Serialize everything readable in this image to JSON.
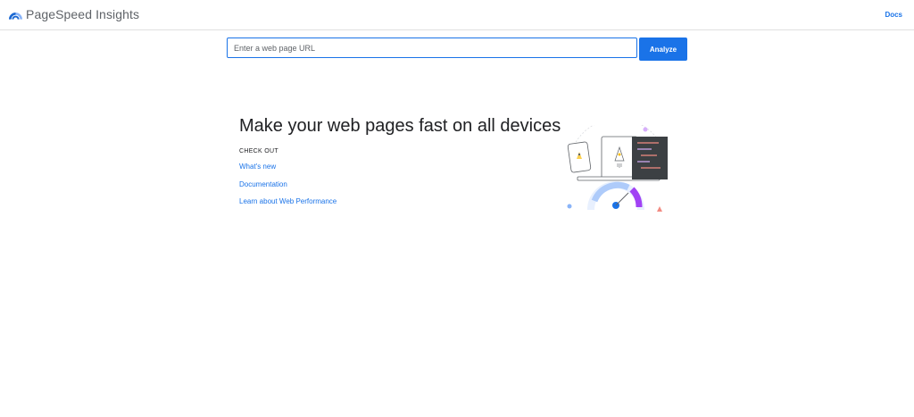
{
  "header": {
    "app_title": "PageSpeed Insights",
    "docs_label": "Docs"
  },
  "search": {
    "placeholder": "Enter a web page URL",
    "value": "",
    "analyze_label": "Analyze"
  },
  "hero": {
    "headline": "Make your web pages fast on all devices",
    "checkout_label": "CHECK OUT",
    "links": [
      "What's new",
      "Documentation",
      "Learn about Web Performance"
    ]
  },
  "colors": {
    "accent": "#1a73e8",
    "logo_dark": "#1967d2",
    "logo_light": "#8ab4f8",
    "illustration_purple": "#a142f4",
    "illustration_pink": "#f28b82"
  }
}
